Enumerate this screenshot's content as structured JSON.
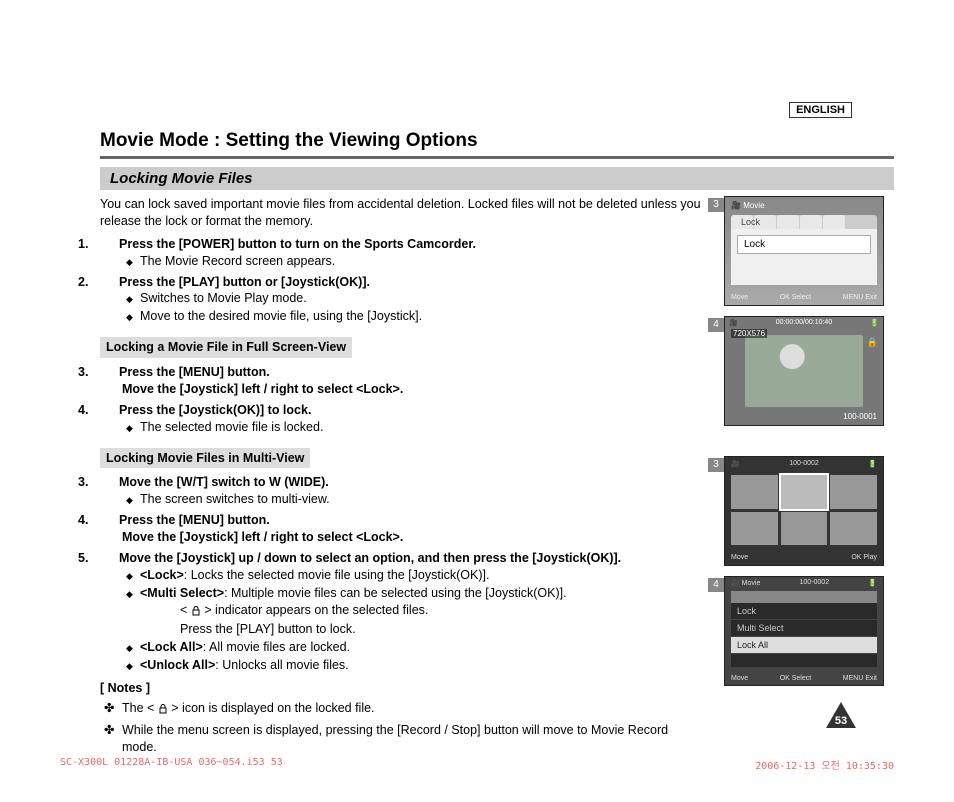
{
  "language_label": "ENGLISH",
  "page_title": "Movie Mode : Setting the Viewing Options",
  "subtitle": "Locking Movie Files",
  "intro": "You can lock saved important movie files from accidental deletion. Locked files will not be deleted unless you release the lock or format the memory.",
  "steps_a": [
    {
      "num": "1.",
      "head": "Press the [POWER] button to turn on the Sports Camcorder.",
      "subs": [
        "The Movie Record screen appears."
      ]
    },
    {
      "num": "2.",
      "head": "Press the [PLAY] button or [Joystick(OK)].",
      "subs": [
        "Switches to Movie Play mode.",
        "Move to the desired movie file, using the [Joystick]."
      ]
    }
  ],
  "section_full": "Locking a Movie File in Full Screen-View",
  "steps_b": [
    {
      "num": "3.",
      "head": "Press the [MENU] button.",
      "head2": "Move the [Joystick] left / right to select <Lock>."
    },
    {
      "num": "4.",
      "head": "Press the [Joystick(OK)] to lock.",
      "subs": [
        "The selected movie file is locked."
      ]
    }
  ],
  "section_multi": "Locking Movie Files in Multi-View",
  "steps_c": [
    {
      "num": "3.",
      "head": "Move the [W/T] switch to W (WIDE).",
      "subs": [
        "The screen switches to multi-view."
      ]
    },
    {
      "num": "4.",
      "head": "Press the [MENU] button.",
      "head2": "Move the [Joystick] left / right to select <Lock>."
    },
    {
      "num": "5.",
      "head": "Move the [Joystick] up / down to select an option, and then press the [Joystick(OK)].",
      "opts": [
        {
          "k": "<Lock>",
          "v": ": Locks the selected movie file using the [Joystick(OK)]."
        },
        {
          "k": "<Multi Select>",
          "v": ": Multiple movie files can be selected using the [Joystick(OK)]."
        },
        {
          "k": "<Lock All>",
          "v": ": All movie files are locked."
        },
        {
          "k": "<Unlock All>",
          "v": ": Unlocks all movie files."
        }
      ],
      "multi_extra1": "> indicator appears on the selected files.",
      "multi_extra2": "Press the [PLAY] button to lock."
    }
  ],
  "notes_head": "[ Notes ]",
  "notes": [
    "> icon is displayed on the locked file.",
    "While the menu screen is displayed, pressing the [Record / Stop] button will move to Movie Record mode."
  ],
  "note0_prefix": "The < ",
  "screens": {
    "s1": {
      "num": "3",
      "top": "Movie",
      "tablabel": "Lock",
      "option": "Lock",
      "bot": [
        "Move",
        "OK Select",
        "MENU Exit"
      ]
    },
    "s2": {
      "num": "4",
      "tc": "00:00:00/00:10:40",
      "count": "720X576",
      "fn": "100-0001"
    },
    "s3": {
      "num": "3",
      "fn": "100-0002",
      "bot": [
        "Move",
        "OK Play"
      ]
    },
    "s4": {
      "num": "4",
      "top": "Movie",
      "fn": "100-0002",
      "rows": [
        "Lock",
        "Multi Select",
        "Lock All"
      ],
      "bot": [
        "Move",
        "OK Select",
        "MENU Exit"
      ]
    }
  },
  "page_number": "53",
  "footer_left": "SC-X300L 01228A-IB-USA 036~054.i53   53",
  "footer_right": "2006-12-13   오전 10:35:30"
}
